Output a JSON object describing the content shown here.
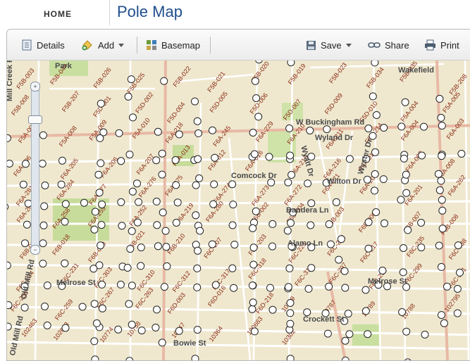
{
  "header": {
    "home": "HOME",
    "title": "Pole Map"
  },
  "toolbar": {
    "details": "Details",
    "add": "Add",
    "basemap": "Basemap",
    "save": "Save",
    "share": "Share",
    "print": "Print"
  },
  "zoom": {
    "in": "+",
    "out": "−"
  },
  "streets": {
    "park": "Park",
    "mill_creek": "Mill Creek Rd",
    "old_mill": "Old Mill Rd",
    "old_mill_2": "Old Mill Rd",
    "wakefield": "Wakefield",
    "buckingham": "W Buckingham Rd",
    "wyland": "Wyland Dr",
    "wyatt": "Wyatt Dr",
    "wyster": "Wyster Dr",
    "comcock": "Comcock Dr",
    "wilton": "Wilton Dr",
    "bandera": "Bandera Ln",
    "alamo": "Alamo Ln",
    "melrose": "Melrose St",
    "melrose_2": "Melrose St",
    "bowie": "Bowie St",
    "crockett": "Crockett St"
  },
  "pole_labels": [
    {
      "t": "F5B-003"
    },
    {
      "t": "F5B-044"
    },
    {
      "t": "F5B-026"
    },
    {
      "t": "F5B-025"
    },
    {
      "t": "F5B-022"
    },
    {
      "t": "F5B-021"
    },
    {
      "t": "F5B-020"
    },
    {
      "t": "F5B-019"
    },
    {
      "t": "F5B-023"
    },
    {
      "t": "F5B-034"
    },
    {
      "t": "F5B-035"
    },
    {
      "t": "F5B-208"
    },
    {
      "t": "F5B-008"
    },
    {
      "t": "F5B-207"
    },
    {
      "t": "F5D-001"
    },
    {
      "t": "F5D-002"
    },
    {
      "t": "F5D-004"
    },
    {
      "t": "F5D-005"
    },
    {
      "t": "F5D-006"
    },
    {
      "t": "F5D-007"
    },
    {
      "t": "F5D-009"
    },
    {
      "t": "F5D-010"
    },
    {
      "t": "F5A-004"
    },
    {
      "t": "F5A-005"
    },
    {
      "t": "F5A-007"
    },
    {
      "t": "F5A-008"
    },
    {
      "t": "F5A-009"
    },
    {
      "t": "F5A-010"
    },
    {
      "t": "F6A-218"
    },
    {
      "t": "F6A-245"
    },
    {
      "t": "F6A-229"
    },
    {
      "t": "F6A-210"
    },
    {
      "t": "F6A-211"
    },
    {
      "t": "F6A-214"
    },
    {
      "t": "F6A-004"
    },
    {
      "t": "F6A-003"
    },
    {
      "t": "F6A-006"
    },
    {
      "t": "F6A-205"
    },
    {
      "t": "F6A-206"
    },
    {
      "t": "F6A-207"
    },
    {
      "t": "F6A-013"
    },
    {
      "t": "F6A-012"
    },
    {
      "t": "F6A-016"
    },
    {
      "t": "F6A-215"
    },
    {
      "t": "F6A-216"
    },
    {
      "t": "F6A-018"
    },
    {
      "t": "F6A-007"
    },
    {
      "t": "F6A-008"
    },
    {
      "t": "F6A-281"
    },
    {
      "t": "F6A-284"
    },
    {
      "t": "F6A-277"
    },
    {
      "t": "F6A-276"
    },
    {
      "t": "F6A-275"
    },
    {
      "t": "F6A-274"
    },
    {
      "t": "F6A-273"
    },
    {
      "t": "F6A-272"
    },
    {
      "t": "F6A-271"
    },
    {
      "t": "F6A-200"
    },
    {
      "t": "F6A-201"
    },
    {
      "t": "F6A-262"
    },
    {
      "t": "F6A-263"
    },
    {
      "t": "F6A-258"
    },
    {
      "t": "F6A-259"
    },
    {
      "t": "F6A-252"
    },
    {
      "t": "F6A-219"
    },
    {
      "t": "F6A-280"
    },
    {
      "t": "F6B-002"
    },
    {
      "t": "F6B-004"
    },
    {
      "t": "F6B-003"
    },
    {
      "t": "F6B-006"
    },
    {
      "t": "F6B-007"
    },
    {
      "t": "F6B-008"
    },
    {
      "t": "F6B-015"
    },
    {
      "t": "F6B-018"
    },
    {
      "t": "F6B-020"
    },
    {
      "t": "F6B-021"
    },
    {
      "t": "F6B-210"
    },
    {
      "t": "F6C-207"
    },
    {
      "t": "F6C-203"
    },
    {
      "t": "F6C-221"
    },
    {
      "t": "F6C-222"
    },
    {
      "t": "F6C-217"
    },
    {
      "t": "F6C-235"
    },
    {
      "t": "F6C-238"
    },
    {
      "t": "F6C-224"
    },
    {
      "t": "F6C-231"
    },
    {
      "t": "F6C-303"
    },
    {
      "t": "F6C-310"
    },
    {
      "t": "F6C-312"
    },
    {
      "t": "F6C-317"
    },
    {
      "t": "F6C-318"
    },
    {
      "t": "F6C-319"
    },
    {
      "t": "F6C-297"
    },
    {
      "t": "F6C-298"
    },
    {
      "t": "F6C-299"
    },
    {
      "t": "F6C-281"
    },
    {
      "t": "F6C-255"
    },
    {
      "t": "F6C-259"
    },
    {
      "t": "F6C-267"
    },
    {
      "t": "F6C-263"
    },
    {
      "t": "F6D-003"
    },
    {
      "t": "F6D-016"
    },
    {
      "t": "F6D-218"
    },
    {
      "t": "10789"
    },
    {
      "t": "10787"
    },
    {
      "t": "10789"
    },
    {
      "t": "10788"
    },
    {
      "t": "102795"
    },
    {
      "t": "102463"
    },
    {
      "t": "102643"
    },
    {
      "t": "10774"
    },
    {
      "t": "10758"
    },
    {
      "t": "10347"
    },
    {
      "t": "10364"
    },
    {
      "t": "100683"
    },
    {
      "t": "10302"
    }
  ]
}
